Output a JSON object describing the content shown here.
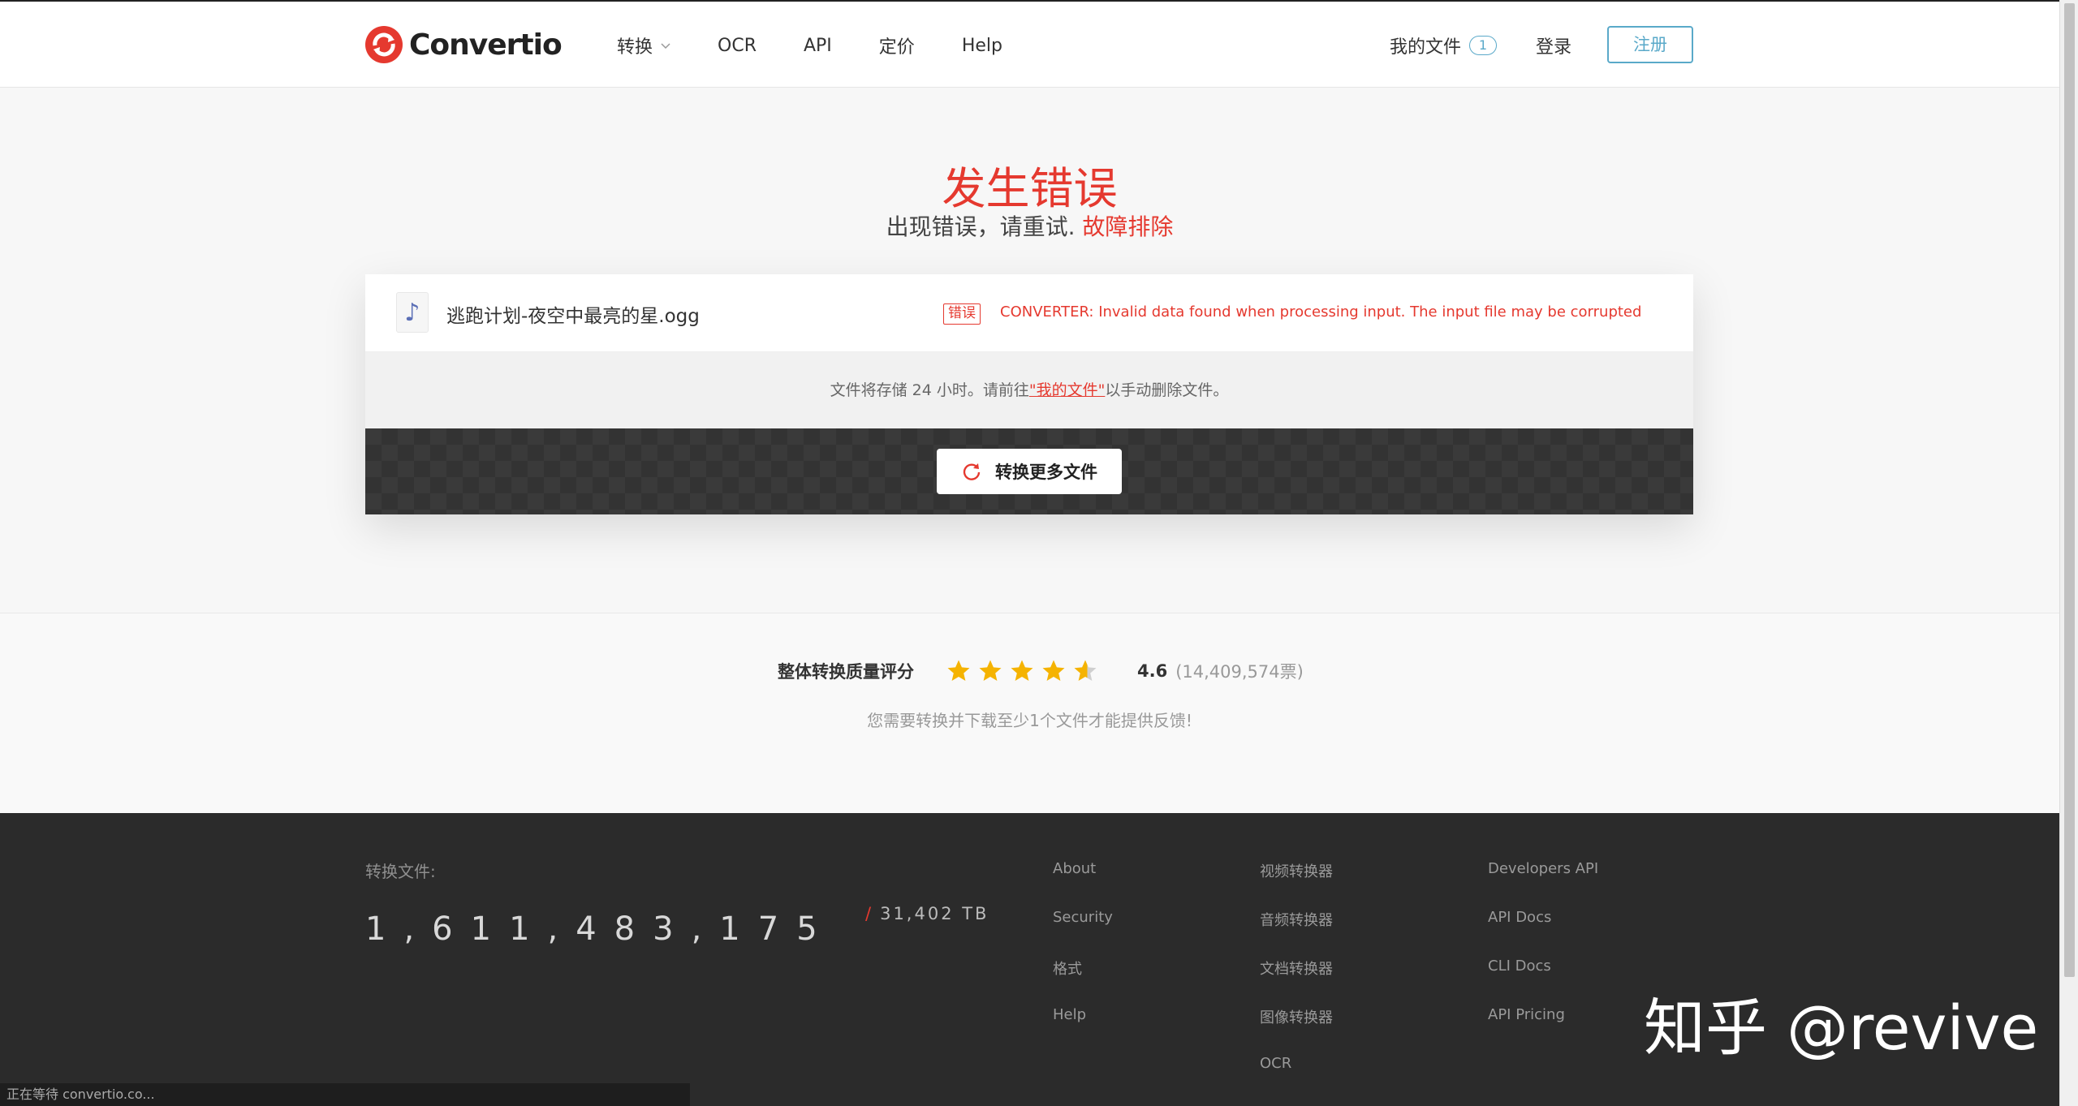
{
  "header": {
    "logo_text": "Convertio",
    "nav": [
      {
        "label": "转换",
        "has_dropdown": true
      },
      {
        "label": "OCR"
      },
      {
        "label": "API"
      },
      {
        "label": "定价"
      },
      {
        "label": "Help"
      }
    ],
    "my_files_label": "我的文件",
    "my_files_count": "1",
    "login_label": "登录",
    "register_label": "注册"
  },
  "error": {
    "title": "发生错误",
    "subtitle": "出现错误，请重试.",
    "troubleshoot_link": "故障排除"
  },
  "file": {
    "icon": "music-note-icon",
    "name": "逃跑计划-夜空中最亮的星.ogg",
    "error_tag": "错误",
    "error_message": "CONVERTER: Invalid data found when processing input. The input file may be corrupted"
  },
  "storage": {
    "prefix": "文件将存储 24 小时。请前往",
    "link": "\"我的文件\"",
    "suffix": "以手动删除文件。"
  },
  "action": {
    "convert_more_label": "转换更多文件",
    "icon": "refresh-icon"
  },
  "rating": {
    "label": "整体转换质量评分",
    "value": "4.6",
    "stars": 4.6,
    "votes": "(14,409,574票)",
    "note": "您需要转换并下载至少1个文件才能提供反馈!"
  },
  "footer": {
    "converted_label": "转换文件:",
    "counter": "1,611,483,175",
    "tb_slash": "/",
    "tb": "31,402 TB",
    "col1": [
      "About",
      "Security",
      "格式",
      "Help"
    ],
    "col2": [
      "视频转换器",
      "音频转换器",
      "文档转换器",
      "图像转换器",
      "OCR"
    ],
    "col3": [
      "Developers API",
      "API Docs",
      "CLI Docs",
      "API Pricing"
    ]
  },
  "watermark": "知乎 @revive",
  "statusbar": "正在等待 convertio.co...",
  "colors": {
    "accent_red": "#e5392f",
    "accent_blue": "#5aa9c9",
    "star_yellow": "#f5b301",
    "footer_bg": "#2b2b2b"
  }
}
